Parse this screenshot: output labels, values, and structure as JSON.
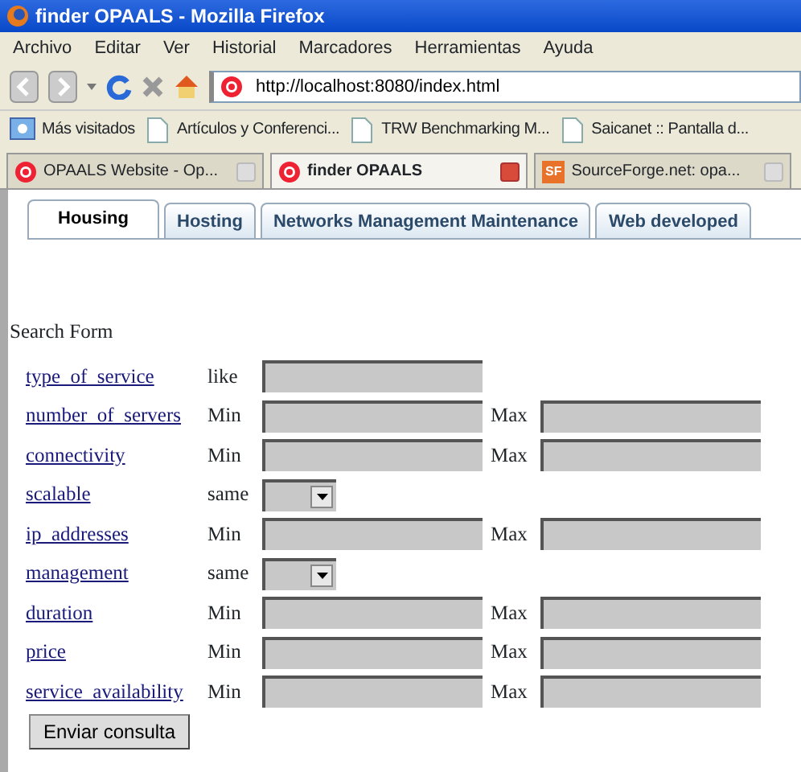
{
  "window": {
    "title": "finder OPAALS - Mozilla Firefox"
  },
  "menu": [
    "Archivo",
    "Editar",
    "Ver",
    "Historial",
    "Marcadores",
    "Herramientas",
    "Ayuda"
  ],
  "address": {
    "value": "http://localhost:8080/index.html"
  },
  "bookmarks": [
    {
      "label": "Más visitados",
      "kind": "smart"
    },
    {
      "label": "Artículos y Conferenci...",
      "kind": "page"
    },
    {
      "label": "TRW Benchmarking M...",
      "kind": "page"
    },
    {
      "label": "Saicanet :: Pantalla d...",
      "kind": "page"
    }
  ],
  "browser_tabs": [
    {
      "label": "OPAALS Website - Op...",
      "selected": false,
      "kind": "opaals"
    },
    {
      "label": "finder OPAALS",
      "selected": true,
      "kind": "opaals"
    },
    {
      "label": "SourceForge.net: opa...",
      "selected": false,
      "kind": "sf",
      "icon_text": "SF"
    }
  ],
  "page_tabs": [
    {
      "label": "Housing",
      "selected": true
    },
    {
      "label": "Hosting",
      "selected": false
    },
    {
      "label": "Networks Management Maintenance",
      "selected": false
    },
    {
      "label": "Web developed",
      "selected": false
    }
  ],
  "form": {
    "title": "Search Form",
    "rows": [
      {
        "label": "type  of  service",
        "kind": "text",
        "operator": "like"
      },
      {
        "label": "number  of  servers",
        "kind": "range",
        "operator": "Min",
        "operator_2": "Max"
      },
      {
        "label": "connectivity",
        "kind": "range",
        "operator": "Min",
        "operator_2": "Max"
      },
      {
        "label": "scalable",
        "kind": "select",
        "operator": "same"
      },
      {
        "label": "ip  addresses",
        "kind": "range",
        "operator": "Min",
        "operator_2": "Max"
      },
      {
        "label": "management",
        "kind": "select",
        "operator": "same"
      },
      {
        "label": "duration",
        "kind": "range",
        "operator": "Min",
        "operator_2": "Max"
      },
      {
        "label": "price",
        "kind": "range",
        "operator": "Min",
        "operator_2": "Max"
      },
      {
        "label": "service  availability",
        "kind": "range",
        "operator": "Min",
        "operator_2": "Max"
      }
    ],
    "submit": "Enviar consulta"
  }
}
